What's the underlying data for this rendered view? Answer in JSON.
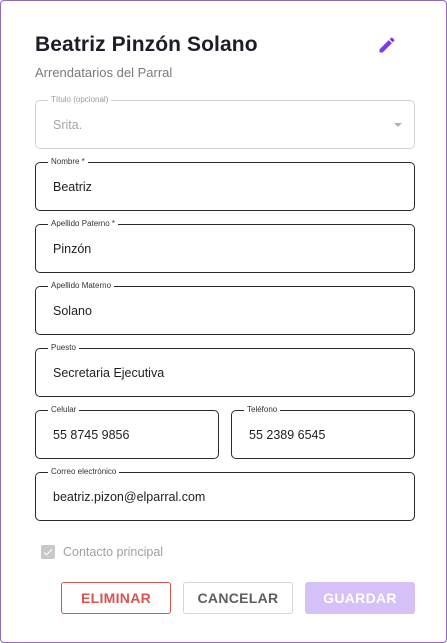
{
  "header": {
    "title": "Beatriz Pinzón Solano",
    "subtitle": "Arrendatarios del Parral",
    "edit_icon": "pencil-icon"
  },
  "form": {
    "titulo": {
      "label": "Título (opcional)",
      "value": "Srita."
    },
    "nombre": {
      "label": "Nombre *",
      "value": "Beatriz"
    },
    "apellido_paterno": {
      "label": "Apellido Paterno *",
      "value": "Pinzón"
    },
    "apellido_materno": {
      "label": "Apellido Materno",
      "value": "Solano"
    },
    "puesto": {
      "label": "Puesto",
      "value": "Secretaria Ejecutiva"
    },
    "celular": {
      "label": "Celular",
      "value": "55 8745 9856"
    },
    "telefono": {
      "label": "Teléfono",
      "value": "55 2389 6545"
    },
    "correo": {
      "label": "Correo electrónico",
      "value": "beatriz.pizon@elparral.com"
    },
    "contacto_principal": {
      "label": "Contacto principal",
      "checked": true
    }
  },
  "actions": {
    "delete_label": "ELIMINAR",
    "cancel_label": "CANCELAR",
    "save_label": "GUARDAR"
  },
  "colors": {
    "accent": "#7c3aed",
    "danger": "#d9534f",
    "save_disabled": "#d5c0f7"
  }
}
